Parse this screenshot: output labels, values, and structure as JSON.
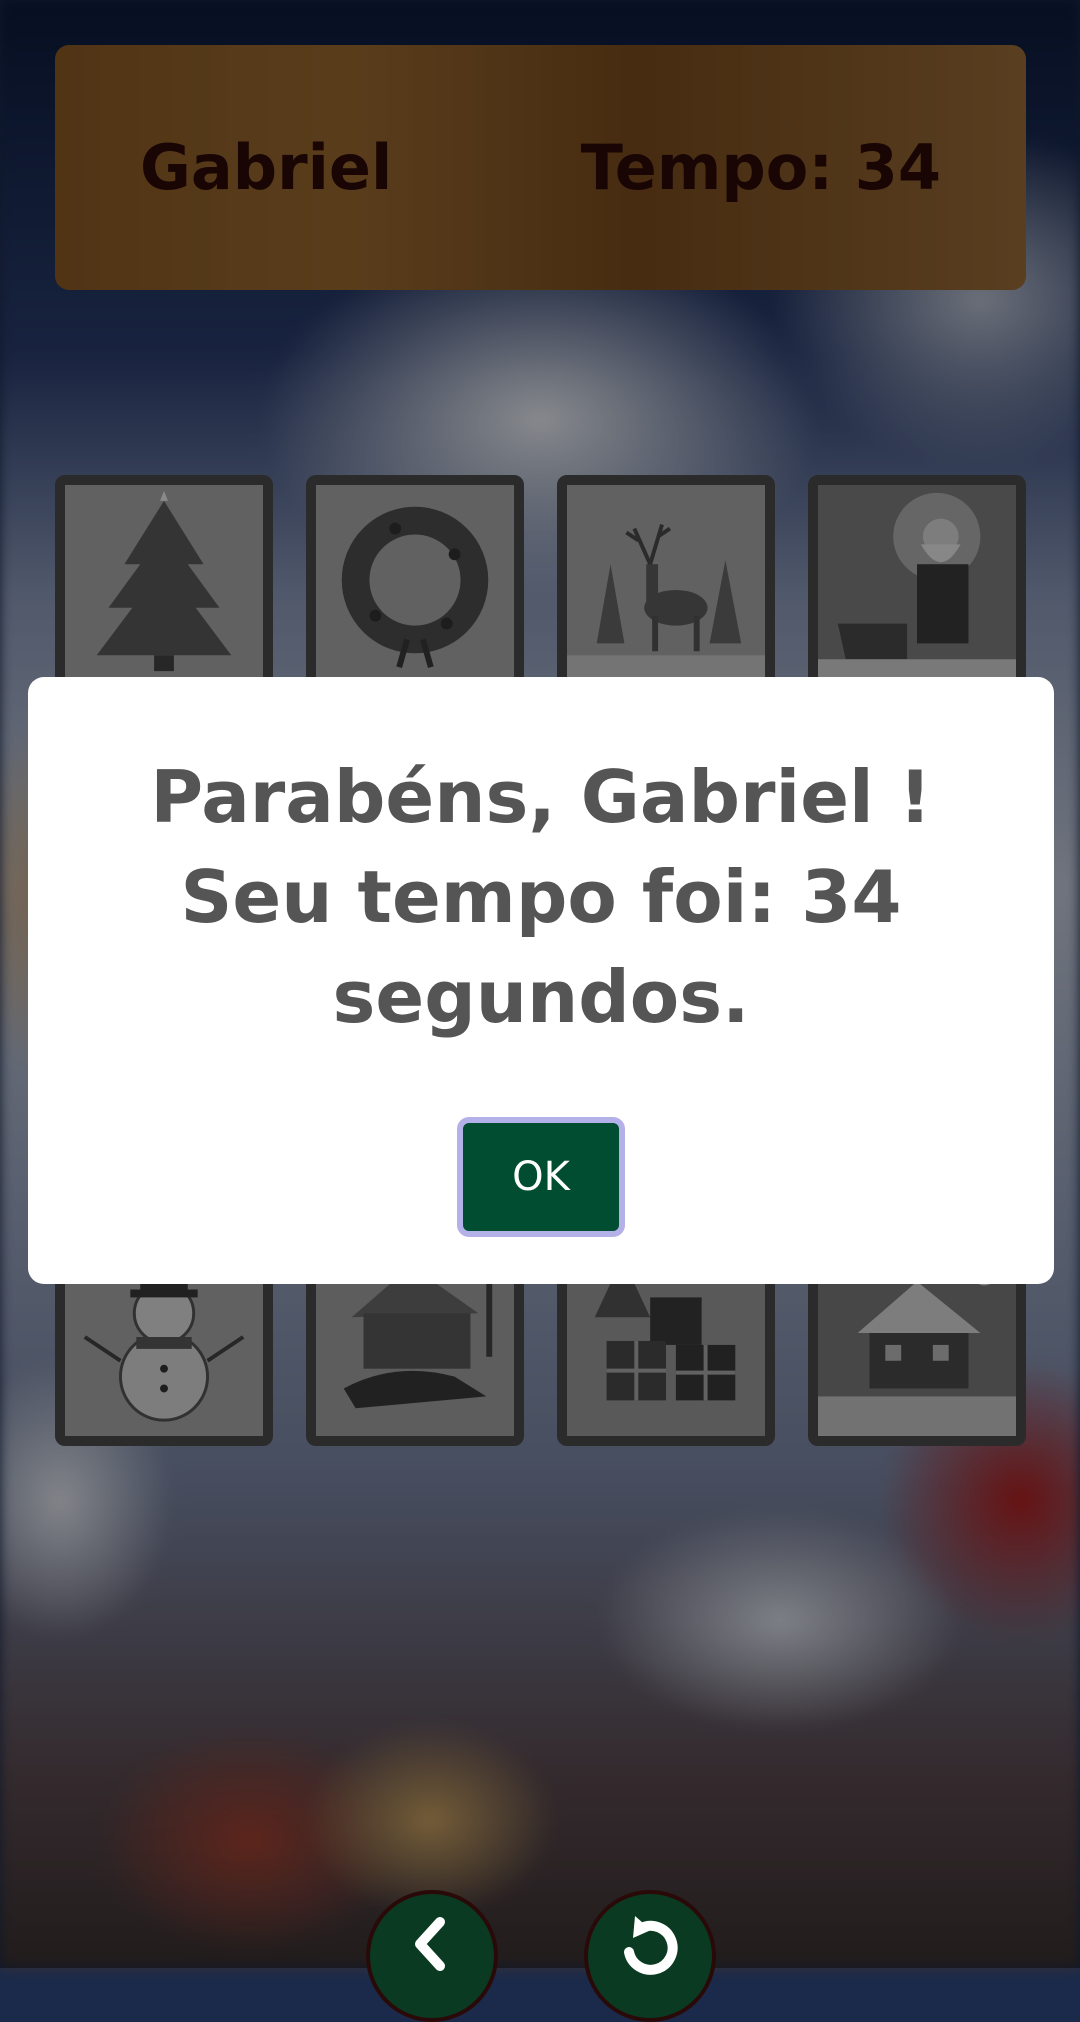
{
  "header": {
    "player_name": "Gabriel",
    "timer_text": "Tempo: 34"
  },
  "cards": [
    {
      "icon": "christmas-tree-icon"
    },
    {
      "icon": "wreath-icon"
    },
    {
      "icon": "reindeer-icon"
    },
    {
      "icon": "santa-claus-icon"
    },
    {
      "icon": "hidden-card"
    },
    {
      "icon": "hidden-card"
    },
    {
      "icon": "hidden-card"
    },
    {
      "icon": "hidden-card"
    },
    {
      "icon": "reindeer-sleigh-icon"
    },
    {
      "icon": "gift-pile-icon"
    },
    {
      "icon": "reindeer-sleigh-icon"
    },
    {
      "icon": "wreath-icon"
    },
    {
      "icon": "snowman-icon"
    },
    {
      "icon": "house-sleigh-icon"
    },
    {
      "icon": "gift-pile-icon"
    },
    {
      "icon": "snowy-house-icon"
    }
  ],
  "modal": {
    "message": "Parabéns, Gabriel ! Seu tempo foi: 34 segundos.",
    "ok_label": "OK"
  },
  "footer": {
    "back_icon": "chevron-left-icon",
    "reload_icon": "reload-icon"
  },
  "colors": {
    "header_bg": "#8a5a24",
    "header_text": "#2a0a08",
    "ok_button_bg": "#004d32",
    "ok_button_border": "#b4b0e8",
    "nav_button_bg": "#0a3a22"
  }
}
